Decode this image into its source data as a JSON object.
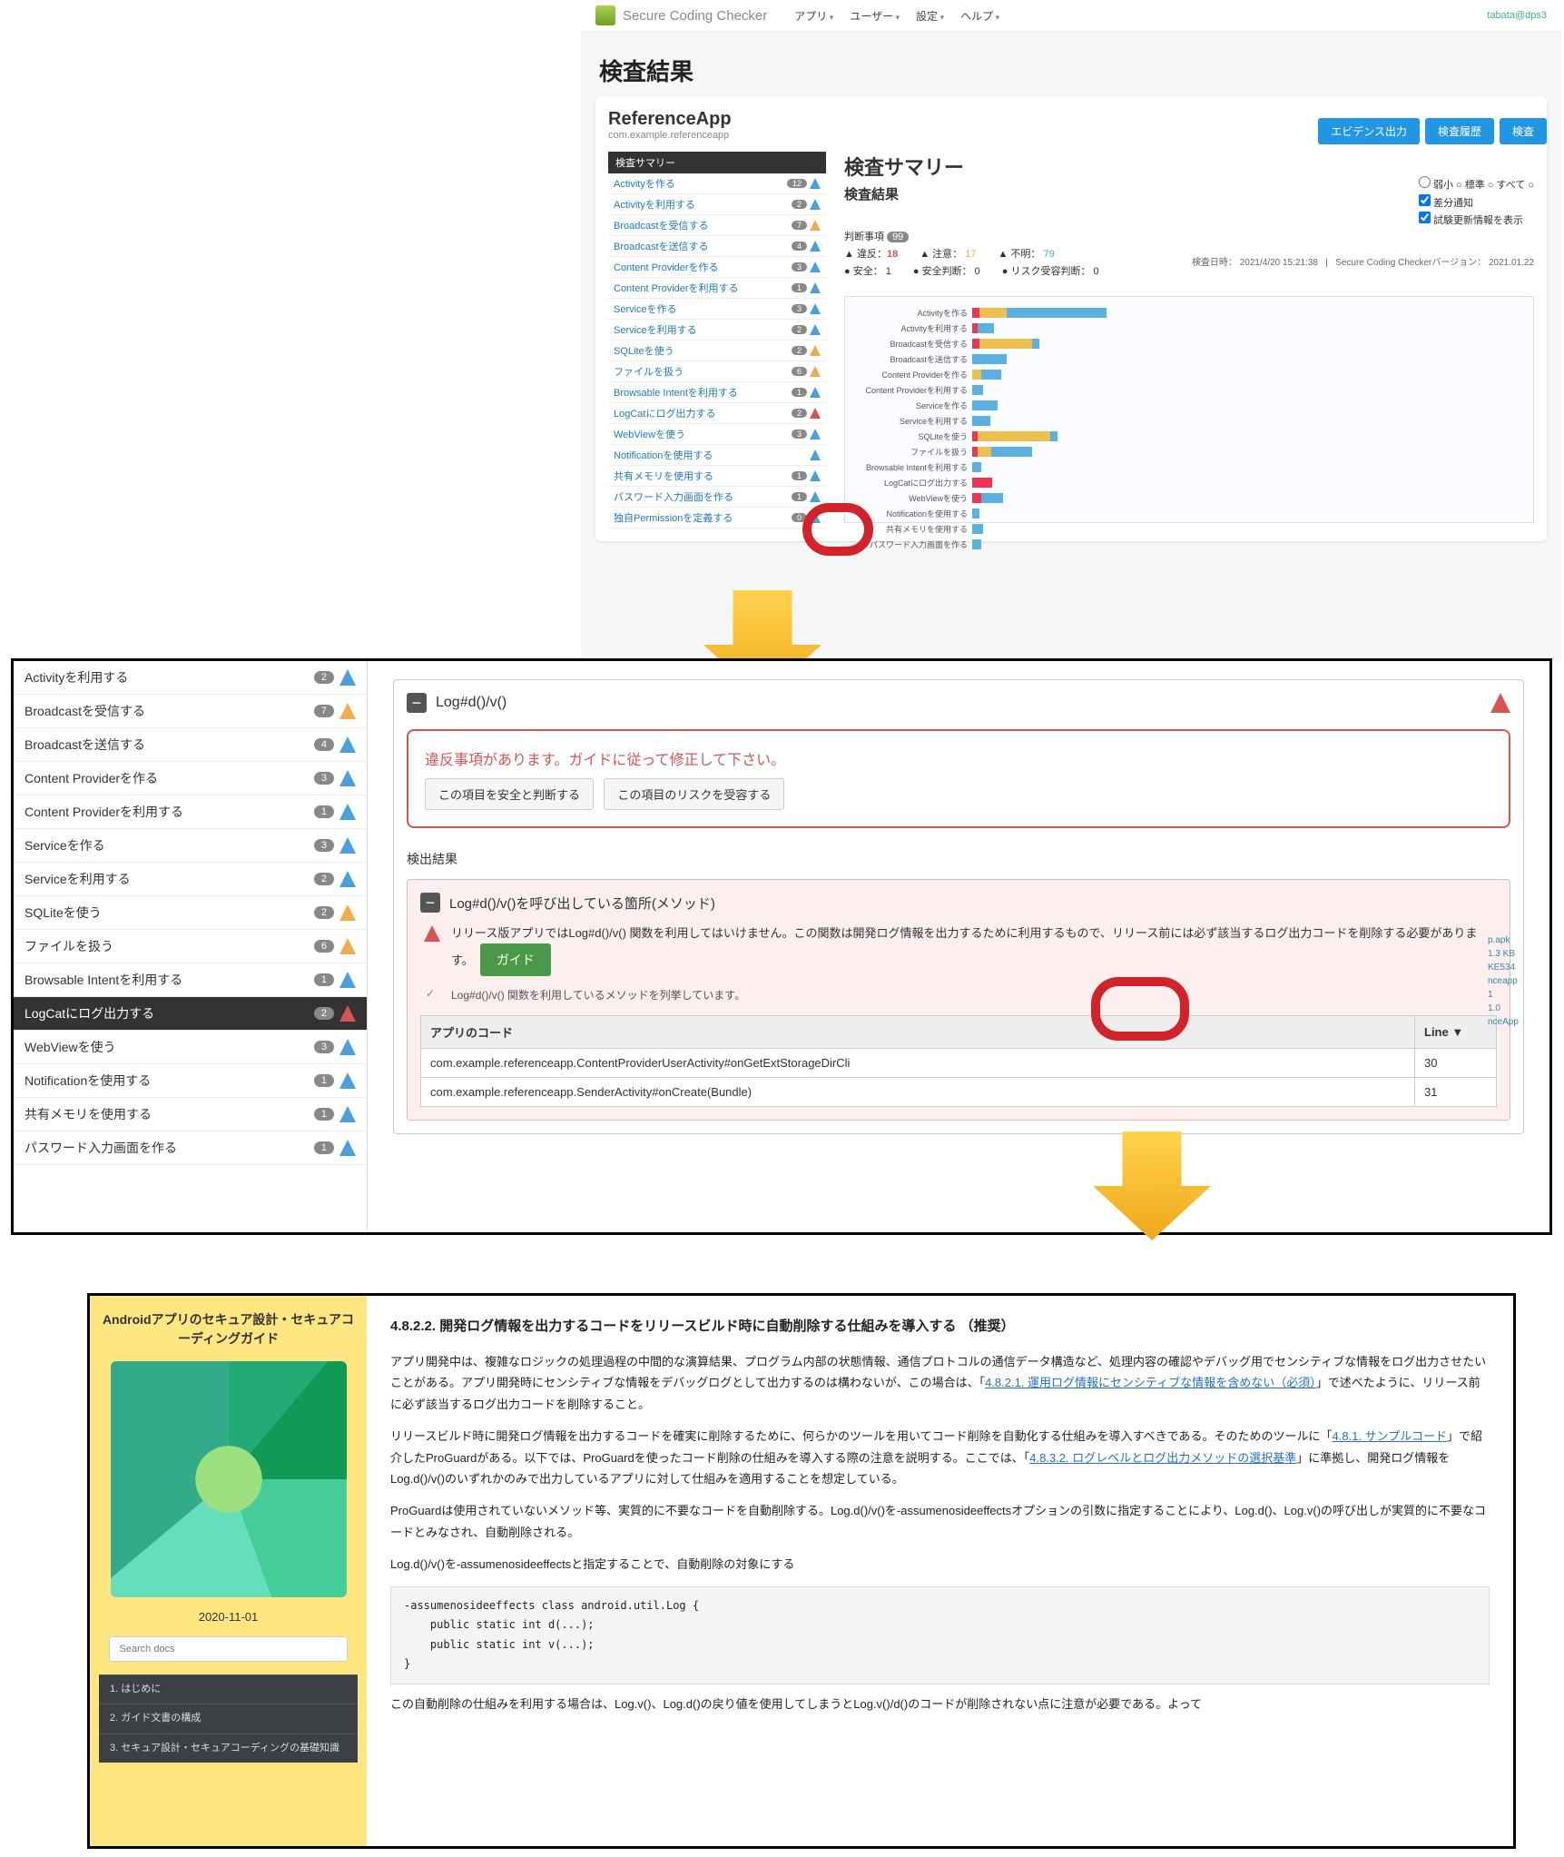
{
  "panel1": {
    "brand": "Secure Coding Checker",
    "menus": [
      "アプリ",
      "ユーザー",
      "設定",
      "ヘルプ"
    ],
    "user": "tabata@dps3",
    "page_title": "検査結果",
    "buttons": {
      "evidence": "エビデンス出力",
      "history": "検査履歴",
      "inspect": "検査"
    },
    "app_name": "ReferenceApp",
    "package": "com.example.referenceapp",
    "opts": {
      "weak": "弱小",
      "normal": "標準",
      "all": "すべて",
      "diff": "差分通知",
      "history_info": "試験更新情報を表示"
    },
    "sidebar_header": "検査サマリー",
    "sidebar_items": [
      {
        "label": "Activityを作る",
        "count": "12",
        "icons": [
          "b"
        ]
      },
      {
        "label": "Activityを利用する",
        "count": "2",
        "icons": [
          "b"
        ]
      },
      {
        "label": "Broadcastを受信する",
        "count": "7",
        "icons": [
          "y"
        ]
      },
      {
        "label": "Broadcastを送信する",
        "count": "4",
        "icons": [
          "b"
        ]
      },
      {
        "label": "Content Providerを作る",
        "count": "3",
        "icons": [
          "b"
        ]
      },
      {
        "label": "Content Providerを利用する",
        "count": "1",
        "icons": [
          "b"
        ]
      },
      {
        "label": "Serviceを作る",
        "count": "3",
        "icons": [
          "b"
        ]
      },
      {
        "label": "Serviceを利用する",
        "count": "2",
        "icons": [
          "b"
        ]
      },
      {
        "label": "SQLiteを使う",
        "count": "2",
        "icons": [
          "y"
        ]
      },
      {
        "label": "ファイルを扱う",
        "count": "6",
        "icons": [
          "y"
        ]
      },
      {
        "label": "Browsable Intentを利用する",
        "count": "1",
        "icons": [
          "b"
        ]
      },
      {
        "label": "LogCatにログ出力する",
        "count": "2",
        "icons": [
          "r"
        ]
      },
      {
        "label": "WebViewを使う",
        "count": "3",
        "icons": [
          "b"
        ]
      },
      {
        "label": "Notificationを使用する",
        "count": "",
        "icons": [
          "b"
        ]
      },
      {
        "label": "共有メモリを使用する",
        "count": "1",
        "icons": [
          "b"
        ]
      },
      {
        "label": "パスワード入力画面を作る",
        "count": "1",
        "icons": [
          "b"
        ]
      },
      {
        "label": "独自Permissionを定義する",
        "count": "0",
        "icons": [
          "b"
        ]
      }
    ],
    "summary_h": "検査サマリー",
    "summary_sub": "検査結果",
    "meta_date": "検査日時： 2021/4/20 15:21:38",
    "meta_ver": "Secure Coding Checkerバージョン： 2021.01.22",
    "stats_hdr": "判断事項",
    "stats_count": "99",
    "stats": {
      "viol_l": "違反：",
      "viol_v": "18",
      "warn_l": "注意：",
      "warn_v": "17",
      "unk_l": "不明：",
      "unk_v": "79",
      "safe_l": "安全：",
      "safe_v": "1",
      "safej_l": "安全判断：",
      "safej_v": "0",
      "risk_l": "リスク受容判断：",
      "risk_v": "0"
    },
    "chart_rows": [
      {
        "label": "Activityを作る",
        "bars": [
          [
            "r",
            8
          ],
          [
            "y",
            30
          ],
          [
            "b",
            110
          ]
        ]
      },
      {
        "label": "Activityを利用する",
        "bars": [
          [
            "r",
            6
          ],
          [
            "b",
            18
          ]
        ]
      },
      {
        "label": "Broadcastを受信する",
        "bars": [
          [
            "r",
            8
          ],
          [
            "y",
            58
          ],
          [
            "b",
            8
          ]
        ]
      },
      {
        "label": "Broadcastを送信する",
        "bars": [
          [
            "b",
            38
          ]
        ]
      },
      {
        "label": "Content Providerを作る",
        "bars": [
          [
            "y",
            10
          ],
          [
            "b",
            22
          ]
        ]
      },
      {
        "label": "Content Providerを利用する",
        "bars": [
          [
            "b",
            12
          ]
        ]
      },
      {
        "label": "Serviceを作る",
        "bars": [
          [
            "b",
            28
          ]
        ]
      },
      {
        "label": "Serviceを利用する",
        "bars": [
          [
            "b",
            20
          ]
        ]
      },
      {
        "label": "SQLiteを使う",
        "bars": [
          [
            "r",
            6
          ],
          [
            "y",
            80
          ],
          [
            "b",
            8
          ]
        ]
      },
      {
        "label": "ファイルを扱う",
        "bars": [
          [
            "r",
            6
          ],
          [
            "y",
            15
          ],
          [
            "b",
            45
          ]
        ]
      },
      {
        "label": "Browsable Intentを利用する",
        "bars": [
          [
            "b",
            10
          ]
        ]
      },
      {
        "label": "LogCatにログ出力する",
        "bars": [
          [
            "r",
            22
          ]
        ]
      },
      {
        "label": "WebViewを使う",
        "bars": [
          [
            "r",
            10
          ],
          [
            "b",
            24
          ]
        ]
      },
      {
        "label": "Notificationを使用する",
        "bars": [
          [
            "b",
            8
          ]
        ]
      },
      {
        "label": "共有メモリを使用する",
        "bars": [
          [
            "b",
            12
          ]
        ]
      },
      {
        "label": "パスワード入力画面を作る",
        "bars": [
          [
            "b",
            10
          ]
        ]
      }
    ]
  },
  "panel2": {
    "side_items": [
      {
        "label": "Activityを利用する",
        "count": "2",
        "icon": "b"
      },
      {
        "label": "Broadcastを受信する",
        "count": "7",
        "icon": "y"
      },
      {
        "label": "Broadcastを送信する",
        "count": "4",
        "icon": "b"
      },
      {
        "label": "Content Providerを作る",
        "count": "3",
        "icon": "b"
      },
      {
        "label": "Content Providerを利用する",
        "count": "1",
        "icon": "b"
      },
      {
        "label": "Serviceを作る",
        "count": "3",
        "icon": "b"
      },
      {
        "label": "Serviceを利用する",
        "count": "2",
        "icon": "b"
      },
      {
        "label": "SQLiteを使う",
        "count": "2",
        "icon": "y"
      },
      {
        "label": "ファイルを扱う",
        "count": "6",
        "icon": "y"
      },
      {
        "label": "Browsable Intentを利用する",
        "count": "1",
        "icon": "b"
      },
      {
        "label": "LogCatにログ出力する",
        "count": "2",
        "icon": "r",
        "active": true
      },
      {
        "label": "WebViewを使う",
        "count": "3",
        "icon": "b"
      },
      {
        "label": "Notificationを使用する",
        "count": "1",
        "icon": "b"
      },
      {
        "label": "共有メモリを使用する",
        "count": "1",
        "icon": "b"
      },
      {
        "label": "パスワード入力画面を作る",
        "count": "1",
        "icon": "b"
      }
    ],
    "section_title": "Log#d()/v()",
    "alert_msg": "違反事項があります。ガイドに従って修正して下さい。",
    "btn_safe": "この項目を安全と判断する",
    "btn_accept": "この項目のリスクを受容する",
    "detect_label": "検出結果",
    "detect_hdr": "Log#d()/v()を呼び出している箇所(メソッド)",
    "detect_text": "リリース版アプリではLog#d()/v() 関数を利用してはいけません。この関数は開発ログ情報を出力するために利用するもので、リリース前には必ず該当するログ出力コードを削除する必要があります。",
    "guide_btn": "ガイド",
    "detect_note": "Log#d()/v() 関数を利用しているメソッドを列挙しています。",
    "tbl_h1": "アプリのコード",
    "tbl_h2": "Line",
    "rows": [
      {
        "code": "com.example.referenceapp.ContentProviderUserActivity#onGetExtStorageDirCli",
        "line": "30"
      },
      {
        "code": "com.example.referenceapp.SenderActivity#onCreate(Bundle)",
        "line": "31"
      }
    ],
    "rside": [
      "p.apk",
      "1.3 KB",
      "KE534",
      "nceapp",
      "1",
      "1.0",
      "nceApp"
    ]
  },
  "panel3": {
    "side_title": "Androidアプリのセキュア設計・セキュアコーディングガイド",
    "date": "2020-11-01",
    "search_ph": "Search docs",
    "nav": [
      "1. はじめに",
      "2. ガイド文書の構成",
      "3. セキュア設計・セキュアコーディングの基礎知識"
    ],
    "h": "4.8.2.2. 開発ログ情報を出力するコードをリリースビルド時に自動削除する仕組みを導入する （推奨）",
    "p1a": "アプリ開発中は、複雑なロジックの処理過程の中間的な演算結果、プログラム内部の状態情報、通信プロトコルの通信データ構造など、処理内容の確認やデバッグ用でセンシティブな情報をログ出力させたいことがある。アプリ開発時にセンシティブな情報をデバッグログとして出力するのは構わないが、この場合は、「",
    "p1link": "4.8.2.1. 運用ログ情報にセンシティブな情報を含めない（必須）",
    "p1b": "」で述べたように、リリース前に必ず該当するログ出力コードを削除すること。",
    "p2a": "リリースビルド時に開発ログ情報を出力するコードを確実に削除するために、何らかのツールを用いてコード削除を自動化する仕組みを導入すべきである。そのためのツールに「",
    "p2l1": "4.8.1. サンプルコード",
    "p2m": "」で紹介したProGuardがある。以下では、ProGuardを使ったコード削除の仕組みを導入する際の注意を説明する。ここでは、「",
    "p2l2": "4.8.3.2. ログレベルとログ出力メソッドの選択基準",
    "p2b": "」に準拠し、開発ログ情報をLog.d()/v()のいずれかのみで出力しているアプリに対して仕組みを適用することを想定している。",
    "p3": "ProGuardは使用されていないメソッド等、実質的に不要なコードを自動削除する。Log.d()/v()を-assumenosideeffectsオプションの引数に指定することにより、Log.d()、Log.v()の呼び出しが実質的に不要なコードとみなされ、自動削除される。",
    "p4": "Log.d()/v()を-assumenosideeffectsと指定することで、自動削除の対象にする",
    "code": "-assumenosideeffects class android.util.Log {\n    public static int d(...);\n    public static int v(...);\n}",
    "p5": "この自動削除の仕組みを利用する場合は、Log.v()、Log.d()の戻り値を使用してしまうとLog.v()/d()のコードが削除されない点に注意が必要である。よって"
  }
}
